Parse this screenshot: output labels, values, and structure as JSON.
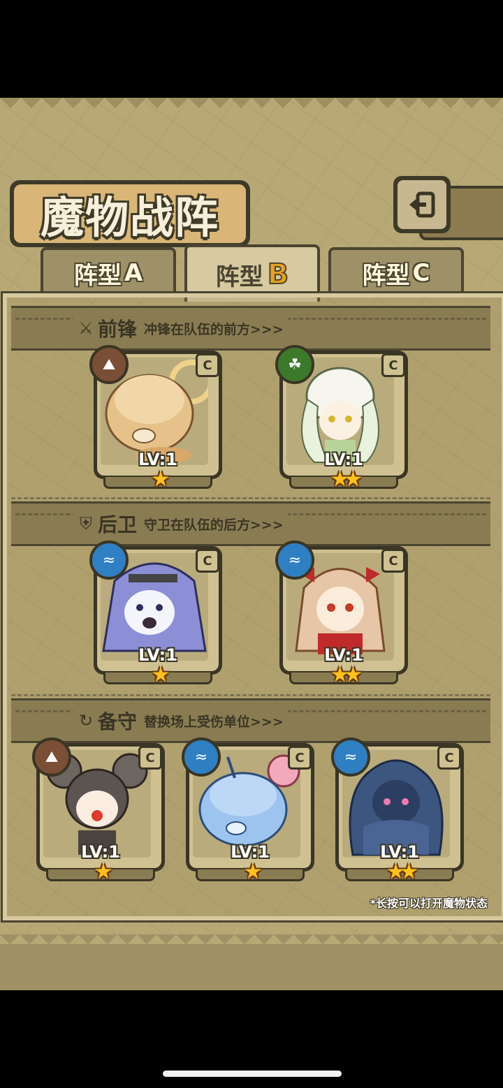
{
  "title": "魔物战阵",
  "tabs": [
    {
      "prefix": "阵型",
      "letter": "A",
      "active": false
    },
    {
      "prefix": "阵型",
      "letter": "B",
      "active": true
    },
    {
      "prefix": "阵型",
      "letter": "C",
      "active": false
    }
  ],
  "sections": [
    {
      "icon": "sword-icon",
      "name": "前锋",
      "desc": "冲锋在队伍的前方>>>"
    },
    {
      "icon": "shield-icon",
      "name": "后卫",
      "desc": "守卫在队伍的后方>>>"
    },
    {
      "icon": "swap-icon",
      "name": "备守",
      "desc": "替换场上受伤单位>>>"
    }
  ],
  "cards": {
    "vanguard": [
      {
        "element": "earth",
        "rank": "C",
        "level": "LV:1",
        "stars": 1
      },
      {
        "element": "grass",
        "rank": "C",
        "level": "LV:1",
        "stars": 2
      }
    ],
    "rearguard": [
      {
        "element": "water",
        "rank": "C",
        "level": "LV:1",
        "stars": 1
      },
      {
        "element": "water",
        "rank": "C",
        "level": "LV:1",
        "stars": 2
      }
    ],
    "reserve": [
      {
        "element": "earth",
        "rank": "C",
        "level": "LV:1",
        "stars": 1
      },
      {
        "element": "water",
        "rank": "C",
        "level": "LV:1",
        "stars": 1
      },
      {
        "element": "water",
        "rank": "C",
        "level": "LV:1",
        "stars": 2
      }
    ]
  },
  "hint": "*长按可以打开魔物状态",
  "colors": {
    "earth": "#7a4f36",
    "grass": "#3b7a2b",
    "water": "#2f7fc3",
    "star": "#ffc21a"
  }
}
